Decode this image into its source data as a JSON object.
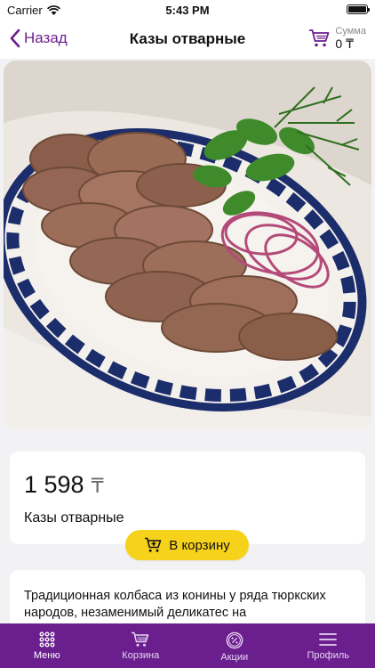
{
  "status_bar": {
    "carrier": "Carrier",
    "time": "5:43 PM"
  },
  "nav": {
    "back_label": "Назад",
    "title": "Казы отварные",
    "sum_label": "Сумма",
    "sum_value": "0 ₸"
  },
  "product": {
    "price": "1 598",
    "currency": "₸",
    "name": "Казы отварные",
    "add_to_cart_label": "В корзину",
    "description": "Традиционная колбаса из конины у ряда тюркских народов, незаменимый деликатес на"
  },
  "tabs": [
    {
      "label": "Меню",
      "icon": "grid-icon",
      "active": true
    },
    {
      "label": "Корзина",
      "icon": "cart-icon",
      "active": false
    },
    {
      "label": "Акции",
      "icon": "percent-icon",
      "active": false
    },
    {
      "label": "Профиль",
      "icon": "menu-lines-icon",
      "active": false
    }
  ],
  "colors": {
    "accent": "#6b1f8f",
    "button": "#f7d21b",
    "background": "#f2f2f4"
  }
}
